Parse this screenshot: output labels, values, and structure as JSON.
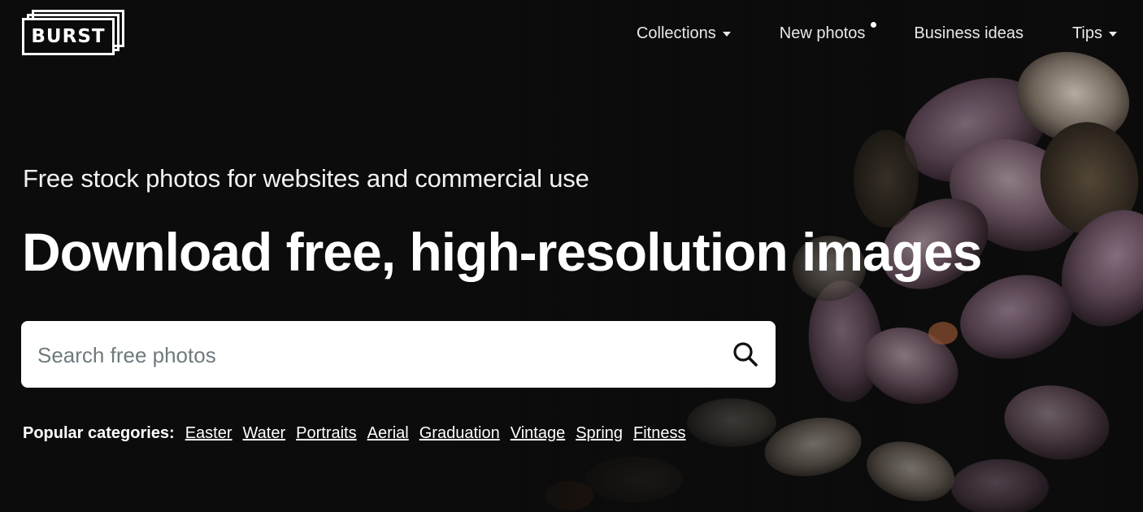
{
  "header": {
    "logo_text": "BURST",
    "nav": {
      "collections": "Collections",
      "new_photos": "New photos",
      "business_ideas": "Business ideas",
      "tips": "Tips"
    }
  },
  "hero": {
    "subtitle": "Free stock photos for websites and commercial use",
    "headline": "Download free, high-resolution images"
  },
  "search": {
    "placeholder": "Search free photos",
    "icon": "search-icon"
  },
  "categories": {
    "label": "Popular categories:",
    "items": [
      "Easter",
      "Water",
      "Portraits",
      "Aerial",
      "Graduation",
      "Vintage",
      "Spring",
      "Fitness"
    ]
  },
  "colors": {
    "background": "#0c0c0c",
    "text": "#ffffff",
    "search_bg": "#ffffff",
    "placeholder": "#6e7a7e"
  }
}
